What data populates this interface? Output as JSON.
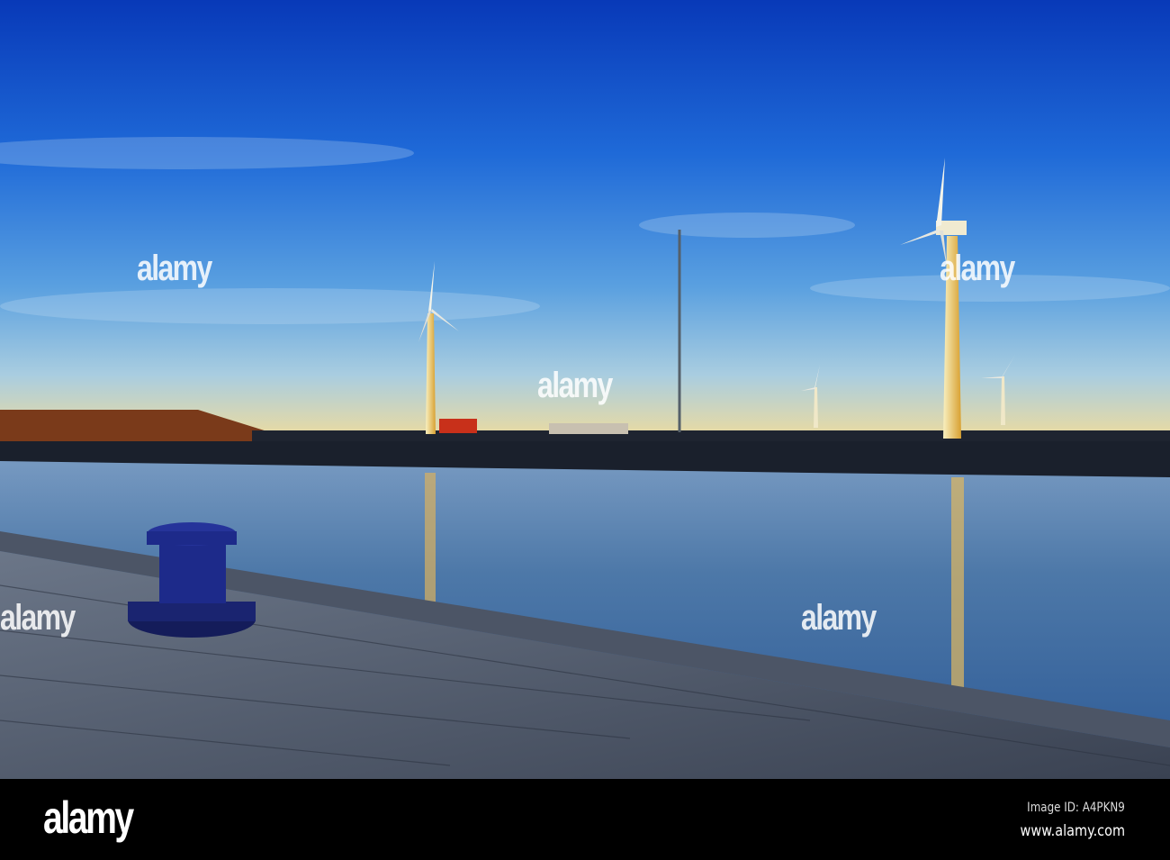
{
  "photo": {
    "subject": "Wind turbines beside a harbour at sunset, wooden jetty with blue mooring bollard",
    "colors": {
      "sky_top": "#0a3fc0",
      "sky_mid": "#2b7de0",
      "horizon": "#e8d9a0",
      "water": "#3f6c9e",
      "deck": "#5b6677",
      "bollard": "#1d2a8a"
    }
  },
  "watermark": {
    "text": "alamy"
  },
  "footer": {
    "logo": "alamy",
    "image_id": "Image ID: A4PKN9",
    "site": "www.alamy.com"
  }
}
